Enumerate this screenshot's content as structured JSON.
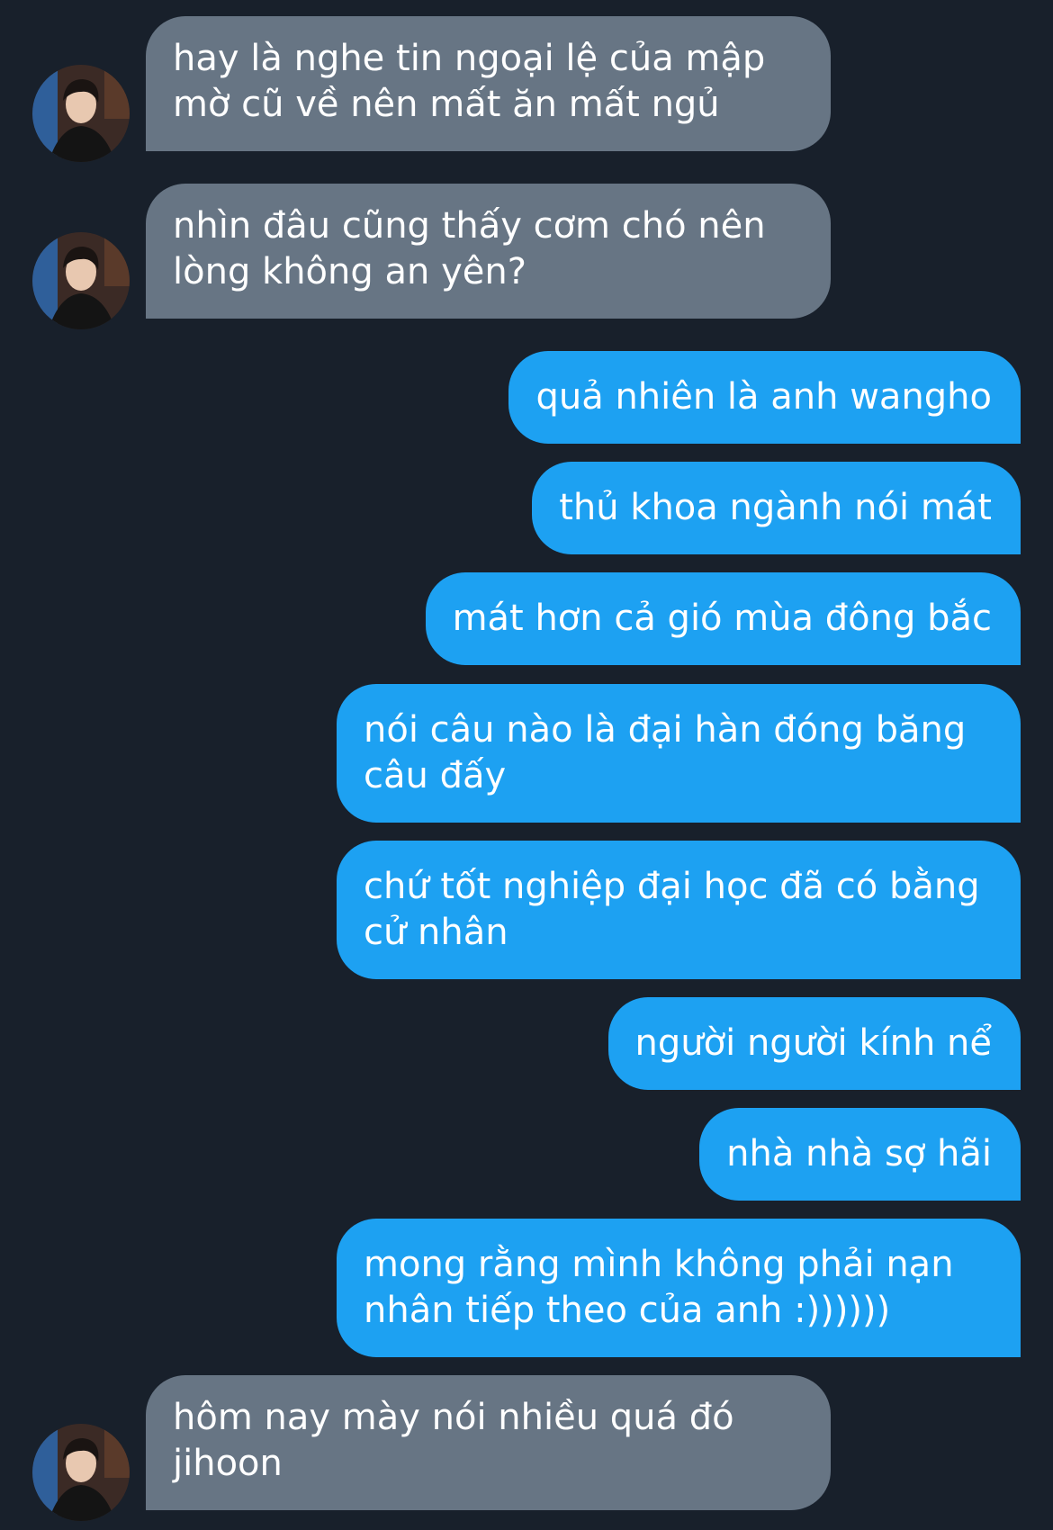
{
  "conversation": {
    "messages": [
      {
        "direction": "received",
        "lines": [
          "hay là nghe tin ngoại lệ của mập",
          "mờ cũ về nên mất ăn mất ngủ"
        ]
      },
      {
        "direction": "received",
        "lines": [
          "nhìn đâu cũng thấy cơm chó nên",
          "lòng không an yên?"
        ]
      },
      {
        "direction": "sent",
        "lines": [
          "quả nhiên là anh wangho"
        ]
      },
      {
        "direction": "sent",
        "lines": [
          "thủ khoa ngành nói mát"
        ]
      },
      {
        "direction": "sent",
        "lines": [
          "mát hơn cả gió mùa đông bắc"
        ]
      },
      {
        "direction": "sent",
        "lines": [
          "nói câu nào là đại hàn đóng băng",
          "câu đấy"
        ]
      },
      {
        "direction": "sent",
        "lines": [
          "chứ tốt nghiệp đại học đã có bằng",
          "cử nhân"
        ]
      },
      {
        "direction": "sent",
        "lines": [
          "người người kính nể"
        ]
      },
      {
        "direction": "sent",
        "lines": [
          "nhà nhà sợ hãi"
        ]
      },
      {
        "direction": "sent",
        "lines": [
          "mong rằng mình không phải nạn",
          "nhân tiếp theo của anh :))))))"
        ]
      },
      {
        "direction": "received",
        "lines": [
          "hôm nay mày nói nhiều quá đó",
          "jihoon"
        ]
      }
    ]
  },
  "colors": {
    "background": "#18202b",
    "received_bubble": "#677584",
    "sent_bubble": "#1da1f2",
    "text": "#ffffff"
  },
  "icons": {
    "avatar": "contact-avatar-photo"
  }
}
